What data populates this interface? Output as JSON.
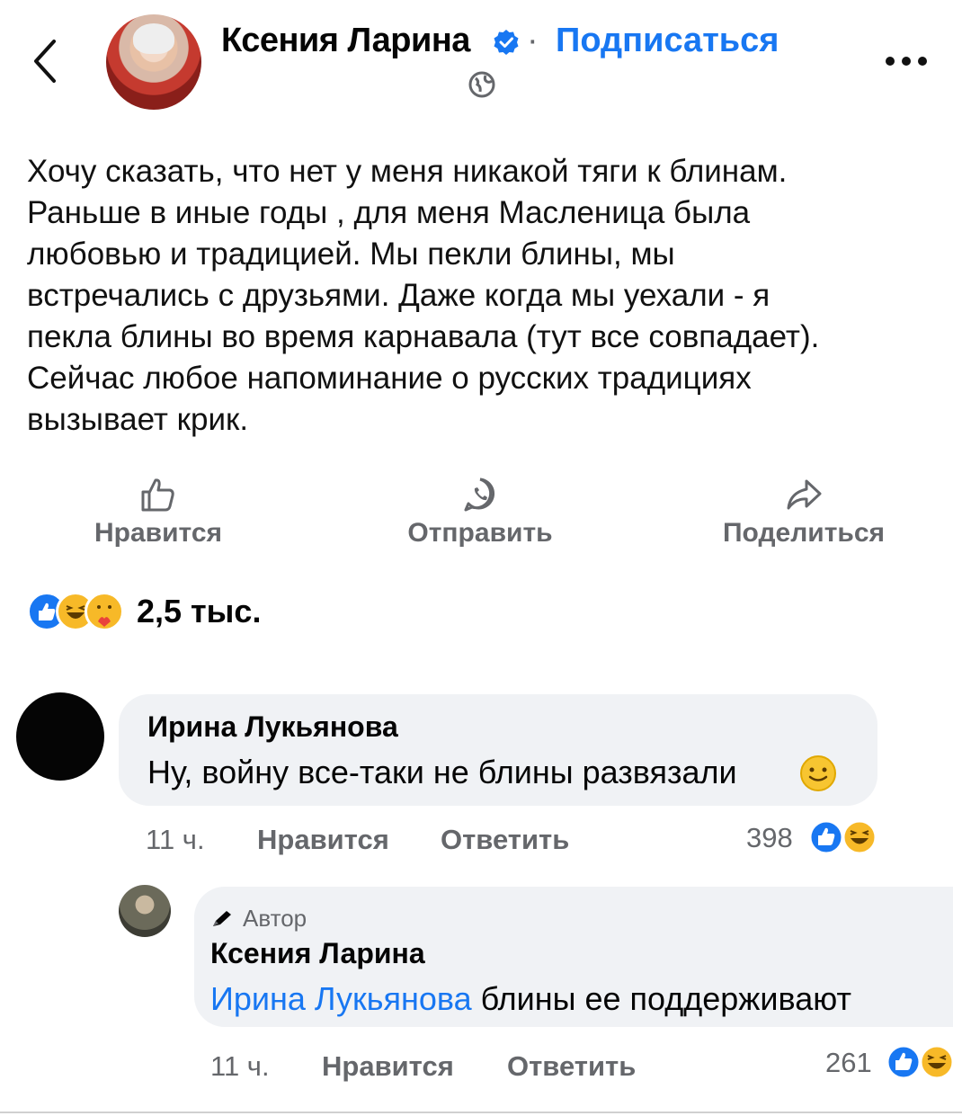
{
  "header": {
    "author_name": "Ксения Ларина",
    "separator": "·",
    "subscribe_label": "Подписаться"
  },
  "post": {
    "text": "Хочу сказать, что нет у меня никакой тяги к блинам.\nРаньше в иные годы , для меня Масленица была\nлюбовью и традицией.  Мы пекли блины, мы\nвстречались с друзьями. Даже когда мы уехали - я\nпекла блины во время карнавала (тут все совпадает).\nСейчас любое напоминание о русских традициях\nвызывает крик."
  },
  "actions": {
    "like_label": "Нравится",
    "send_label": "Отправить",
    "share_label": "Поделиться"
  },
  "reactions": {
    "count": "2,5 тыс.",
    "icons": [
      "like-icon",
      "haha-icon",
      "care-icon"
    ]
  },
  "comments": [
    {
      "author": "Ирина Лукьянова",
      "text": "Ну, войну все-таки не блины развязали",
      "time": "11 ч.",
      "like_label": "Нравится",
      "reply_label": "Ответить",
      "reaction_count": "398"
    },
    {
      "badge": "Автор",
      "author": "Ксения Ларина",
      "mention": "Ирина Лукьянова",
      "text": " блины ее поддерживают",
      "time": "11 ч.",
      "like_label": "Нравится",
      "reply_label": "Ответить",
      "reaction_count": "261"
    }
  ],
  "colors": {
    "accent": "#1877f2",
    "muted": "#65676b",
    "bubble": "#f0f2f5"
  }
}
